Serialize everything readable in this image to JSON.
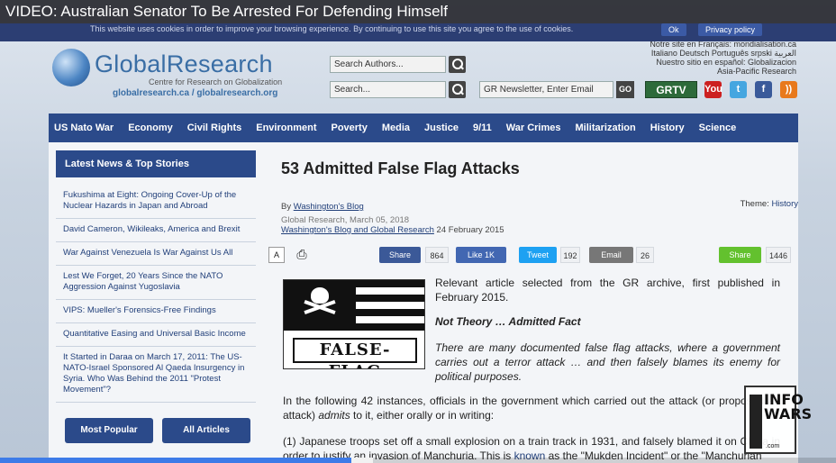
{
  "video": {
    "title": "VIDEO: Australian Senator To Be Arrested For Defending Himself",
    "progress": 0.42
  },
  "cookie_bar": {
    "text": "This website uses cookies in order to improve your browsing experience. By continuing to use this site you agree to the use of cookies.",
    "ok_label": "Ok",
    "policy_label": "Privacy policy"
  },
  "header": {
    "logo_title": "GlobalResearch",
    "logo_subtitle": "Centre for Research on Globalization",
    "logo_urls": "globalresearch.ca / globalresearch.org",
    "search_authors_placeholder": "Search Authors...",
    "search_placeholder": "Search...",
    "newsletter_placeholder": "GR Newsletter, Enter Email",
    "go_label": "GO",
    "grtv_label": "GRTV",
    "lang_line1": "Notre site en Français: mondialisation.ca",
    "lang_line2": "Italiano  Deutsch  Português  srpski  العربية",
    "lang_line3": "Nuestro sitio en español: Globalizacion",
    "lang_line4": "Asia-Pacific Research",
    "social": [
      {
        "icon": "youtube-icon",
        "label": "You",
        "color": "#cc2020"
      },
      {
        "icon": "twitter-icon",
        "label": "t",
        "color": "#45a6e0"
      },
      {
        "icon": "facebook-icon",
        "label": "f",
        "color": "#3a5a9a"
      },
      {
        "icon": "rss-icon",
        "label": "))",
        "color": "#e8791c"
      }
    ]
  },
  "nav": {
    "items": [
      "US Nato War",
      "Economy",
      "Civil Rights",
      "Environment",
      "Poverty",
      "Media",
      "Justice",
      "9/11",
      "War Crimes",
      "Militarization",
      "History",
      "Science"
    ]
  },
  "sidebar": {
    "heading": "Latest News & Top Stories",
    "items": [
      "Fukushima at Eight: Ongoing Cover-Up of the Nuclear Hazards in Japan and Abroad",
      "David Cameron, Wikileaks, America and Brexit",
      "War Against Venezuela Is War Against Us All",
      "Lest We Forget, 20 Years Since the NATO Aggression Against Yugoslavia",
      "VIPS: Mueller's Forensics-Free Findings",
      "Quantitative Easing and Universal Basic Income",
      "It Started in Daraa on March 17, 2011: The US-NATO-Israel Sponsored Al Qaeda Insurgency in Syria. Who Was Behind the 2011 \"Protest Movement\"?"
    ],
    "most_popular_label": "Most Popular",
    "all_articles_label": "All Articles"
  },
  "article": {
    "title": "53 Admitted False Flag Attacks",
    "by_prefix": "By ",
    "author": "Washington's Blog",
    "theme_prefix": "Theme: ",
    "theme": "History",
    "published": "Global Research, March 05, 2018",
    "source_link": "Washington's Blog and Global Research",
    "source_date": " 24 February 2015",
    "font_icon_label": "A",
    "share": [
      {
        "name": "facebook-share",
        "label": "Share",
        "count": "864",
        "color": "#3b5998"
      },
      {
        "name": "facebook-like",
        "label": "Like 1K",
        "count": "",
        "color": "#4267b2"
      },
      {
        "name": "twitter-tweet",
        "label": "Tweet",
        "count": "192",
        "color": "#1da1f2"
      },
      {
        "name": "email-share",
        "label": "Email",
        "count": "26",
        "color": "#777777"
      },
      {
        "name": "generic-share",
        "label": "Share",
        "count": "1446",
        "color": "#63c12e"
      }
    ],
    "image_label": "FALSE-FLAG",
    "intro": "Relevant article selected from the GR archive, first published in February 2015.",
    "subhead": "Not Theory … Admitted Fact",
    "quote": "There are many documented false flag attacks, where a government carries out a terror attack … and then falsely blames its enemy for political purposes.",
    "p1_a": "In the following 42 instances, officials in the government which carried out the attack (or proposed an attack) ",
    "p1_em": "admits",
    "p1_b": " to it, either orally or in writing:",
    "p2_a": "(1) Japanese troops set off a small explosion on a train track in 1931, and falsely blamed it on China in order to justify an invasion of Manchuria. This is ",
    "p2_link": "known",
    "p2_b": " as the \"Mukden Incident\" or the \"Manchurian"
  },
  "watermark": {
    "text": "INFO WARS",
    "sub": ".com"
  }
}
